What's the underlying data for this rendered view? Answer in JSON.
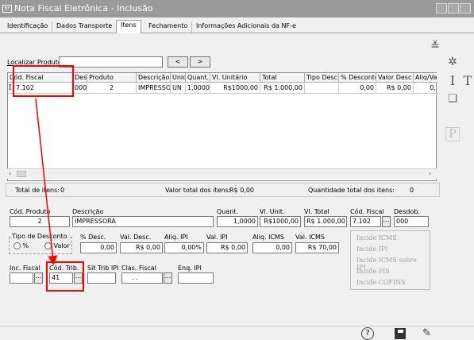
{
  "window": {
    "title": "Nota Fiscal Eletrônica - Inclusão",
    "icon": "nfe-app-icon"
  },
  "tabs": [
    {
      "label": "Identificação",
      "active": false
    },
    {
      "label": "Dados Transporte",
      "active": false
    },
    {
      "label": "Itens",
      "active": true
    },
    {
      "label": "Fechamento",
      "active": false
    },
    {
      "label": "Informações Adicionais da NF-e",
      "active": false
    }
  ],
  "search": {
    "label": "Localizar Produto",
    "value": "",
    "prev": "<",
    "next": ">"
  },
  "grid": {
    "columns": [
      "Cód. Fiscal",
      "Desc",
      "Produto",
      "Descrição",
      "Unid",
      "Quant.",
      "Vl. Unitário",
      "Total",
      "Tipo Desc.",
      "% Desconto",
      "Valor Desc",
      "Aliq/Va"
    ],
    "row": [
      "7.102",
      "000",
      "2",
      "IMPRESSOR",
      "UN",
      "1,0000",
      "R$1000,00",
      "R$ 1.000,00",
      "",
      "0,00",
      "R$ 0,00",
      "0,"
    ]
  },
  "totals": {
    "items_label": "Total de itens:",
    "items_value": "0",
    "value_label": "Valor total dos itens:",
    "value_value": "R$ 0,00",
    "qty_label": "Quantidade total dos itens:",
    "qty_value": "0"
  },
  "form": {
    "cod_produto": {
      "label": "Cód. Produto",
      "value": "2"
    },
    "descricao": {
      "label": "Descrição",
      "value": "IMPRESSORA"
    },
    "quant": {
      "label": "Quant.",
      "value": "1,0000"
    },
    "vl_unit": {
      "label": "Vl. Unit.",
      "value": "R$1000,00"
    },
    "vl_total": {
      "label": "Vl. Total",
      "value": "R$ 1.000,00"
    },
    "cod_fiscal": {
      "label": "Cód. Fiscal",
      "value": "7.102",
      "lookup": "..."
    },
    "desdob": {
      "label": "Desdob.",
      "value": "000"
    },
    "tipo_desconto": {
      "label": "Tipo de Desconto",
      "opt_pct": "%",
      "opt_valor": "Valor"
    },
    "pct_desc": {
      "label": "% Desc.",
      "value": "0,00"
    },
    "val_desc": {
      "label": "Val. Desc.",
      "value": "R$ 0,00"
    },
    "aliq_ipi": {
      "label": "Aliq. IPI",
      "value": "0,00%"
    },
    "val_ipi": {
      "label": "Val. IPI",
      "value": "R$ 0,00"
    },
    "aliq_icms": {
      "label": "Aliq. ICMS",
      "value": "0,00"
    },
    "val_icms": {
      "label": "Val. ICMS",
      "value": "R$ 70,00"
    },
    "inc_fiscal": {
      "label": "Inc. Fiscal",
      "value": "",
      "lookup": "..."
    },
    "cod_trib": {
      "label": "Cód. Trib.",
      "value": "41",
      "lookup": "..."
    },
    "sit_trib_ipi": {
      "label": "Sit Trib IPI",
      "value": ""
    },
    "clas_fiscal": {
      "label": "Clas. Fiscal",
      "value": ". .",
      "lookup": "..."
    },
    "enq_ipi": {
      "label": "Enq. IPI",
      "value": ""
    }
  },
  "incide": [
    "Incide ICMS",
    "Incide IPI",
    "Incide ICMS sobre IPI",
    "Incide PIS",
    "Incide COFINS"
  ],
  "side_toolbar": [
    "I",
    "T",
    "P"
  ],
  "colors": {
    "highlight": "#ff0000",
    "titlebar": "#9a9a9a"
  }
}
